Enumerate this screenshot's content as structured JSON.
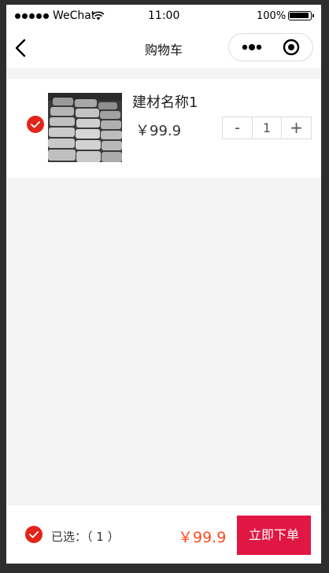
{
  "status_bar": {
    "carrier": "WeChat",
    "time": "11:00",
    "battery": "100%"
  },
  "nav": {
    "title": "购物车"
  },
  "cart": {
    "items": [
      {
        "name": "建材名称1",
        "price": "￥99.9",
        "quantity": "1",
        "checked": true,
        "decrement_label": "-",
        "increment_label": "+"
      }
    ]
  },
  "footer": {
    "selected_label": "已选：（ 1 ）",
    "total": "￥99.9",
    "order_button": "立即下单"
  },
  "colors": {
    "accent_red": "#e01743",
    "check_red": "#e1251b",
    "price_orange": "#ff4a1c",
    "background": "#f4f4f4"
  },
  "icons": [
    "back-arrow-icon",
    "more-dots-icon",
    "capsule-close-icon",
    "wifi-icon",
    "check-circle-icon"
  ]
}
